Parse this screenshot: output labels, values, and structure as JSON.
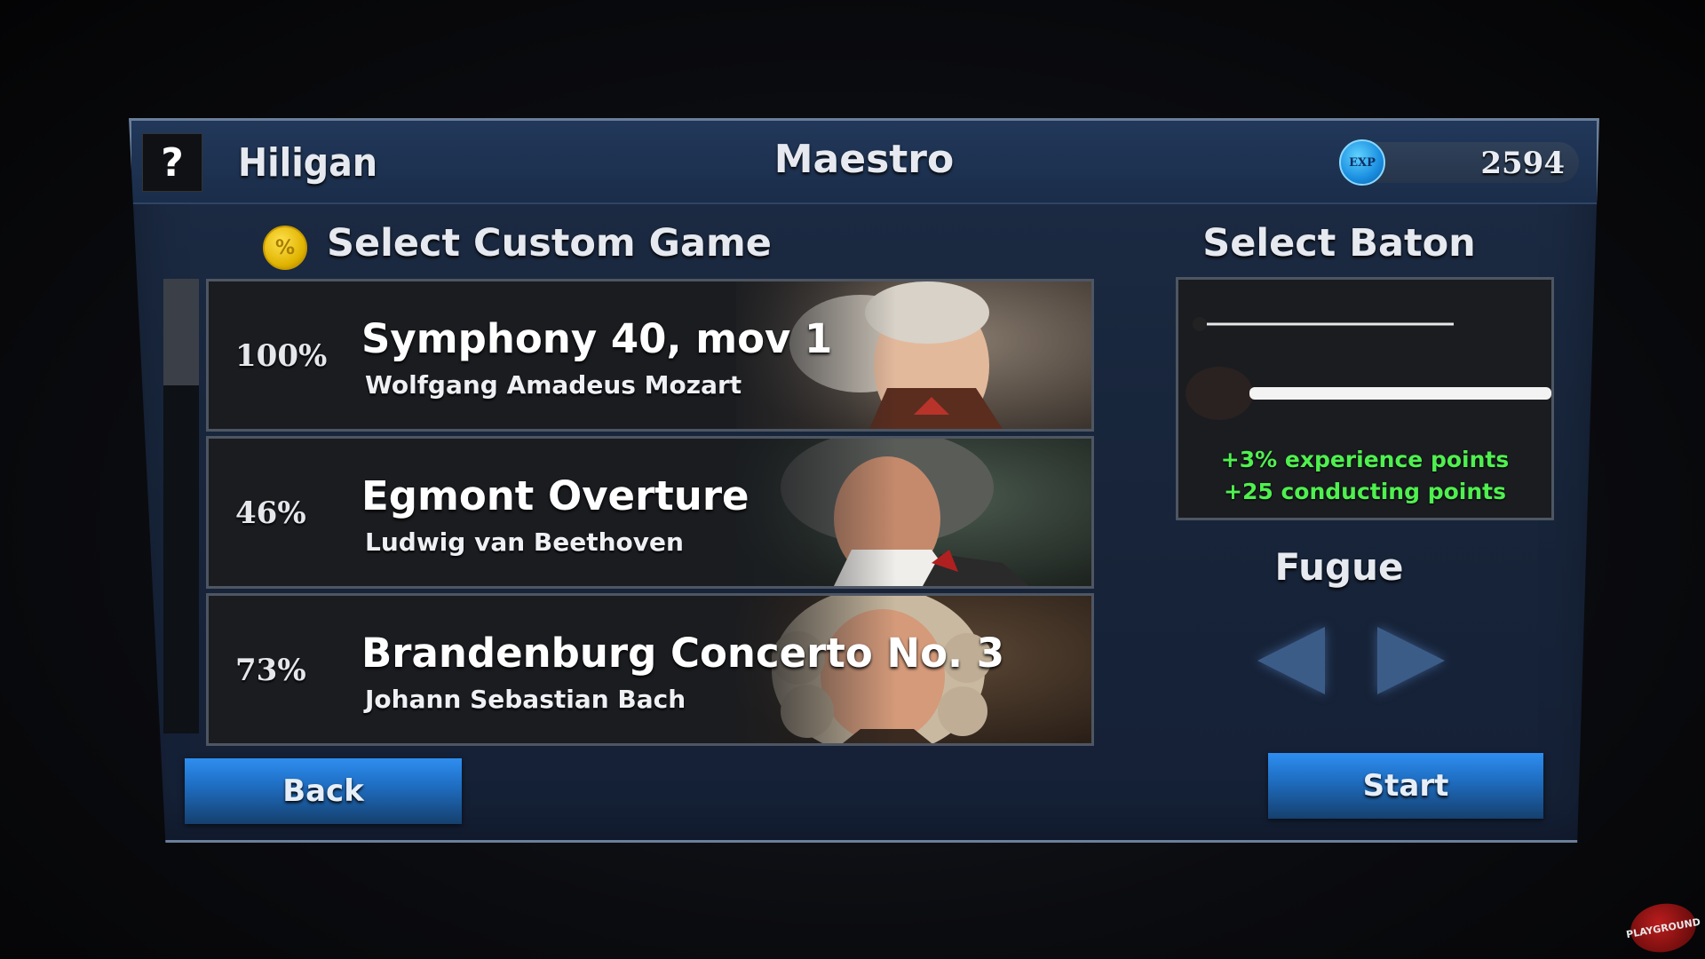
{
  "header": {
    "help_label": "?",
    "player_name": "Hiligan",
    "game_title": "Maestro",
    "exp_icon_label": "EXP",
    "exp_value": "2594"
  },
  "custom_game": {
    "section_title": "Select Custom Game",
    "coin_icon_label": "%",
    "songs": [
      {
        "percent": "100%",
        "title": "Symphony 40, mov 1",
        "composer": "Wolfgang Amadeus Mozart"
      },
      {
        "percent": "46%",
        "title": "Egmont Overture",
        "composer": "Ludwig van Beethoven"
      },
      {
        "percent": "73%",
        "title": "Brandenburg Concerto No. 3",
        "composer": "Johann Sebastian Bach"
      }
    ]
  },
  "baton": {
    "section_title": "Select Baton",
    "bonus_1": "+3% experience points",
    "bonus_2": "+25 conducting points",
    "name": "Fugue"
  },
  "buttons": {
    "back": "Back",
    "start": "Start"
  },
  "watermark": "PLAYGROUND",
  "colors": {
    "panel": "#1a2b45",
    "button_blue": "#1f6fc4",
    "bonus_green": "#4ff04f",
    "exp_blue": "#1a8ee0",
    "coin_gold": "#e0b300"
  }
}
